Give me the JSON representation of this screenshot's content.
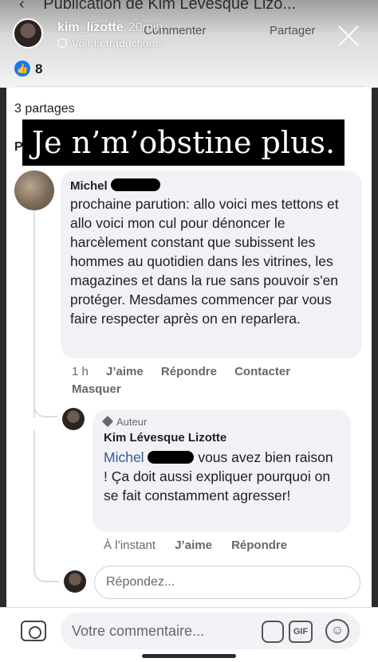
{
  "header": {
    "page_title": "Publication de Kim Lévesque Lizo...",
    "action_comment": "Commenter",
    "action_share": "Partager"
  },
  "story": {
    "user": "kim_lizotte",
    "time": "20min",
    "translate": "Voir la traduction",
    "caption": "Je n’m’obstine plus."
  },
  "post": {
    "like_count": "8",
    "shares": "3 partages"
  },
  "comment1": {
    "author": "Michel",
    "text": "prochaine parution: allo voici mes tettons et allo voici mon cul pour dénoncer le harcèlement constant que subissent les hommes au quotidien dans les vitrines, les magazines et dans la rue sans pouvoir s'en protéger. Mesdames commencer par vous faire respecter après on en reparlera.",
    "time": "1 h",
    "like": "J’aime",
    "reply": "Répondre",
    "contact": "Contacter",
    "hide": "Masquer"
  },
  "reply1": {
    "badge": "Auteur",
    "author": "Kim Lévesque Lizotte",
    "mention": "Michel",
    "text": " vous avez bien raison ! Ça doit aussi expliquer pourquoi on se fait constamment agresser!",
    "time": "À l’instant",
    "like": "J’aime",
    "reply": "Répondre"
  },
  "reply_box": {
    "placeholder": "Répondez..."
  },
  "composer": {
    "placeholder": "Votre commentaire...",
    "gif": "GIF"
  },
  "colors": {
    "facebook_blue": "#1877f2",
    "bubble_bg": "#f0f2f5",
    "caption_bg": "#000000"
  }
}
